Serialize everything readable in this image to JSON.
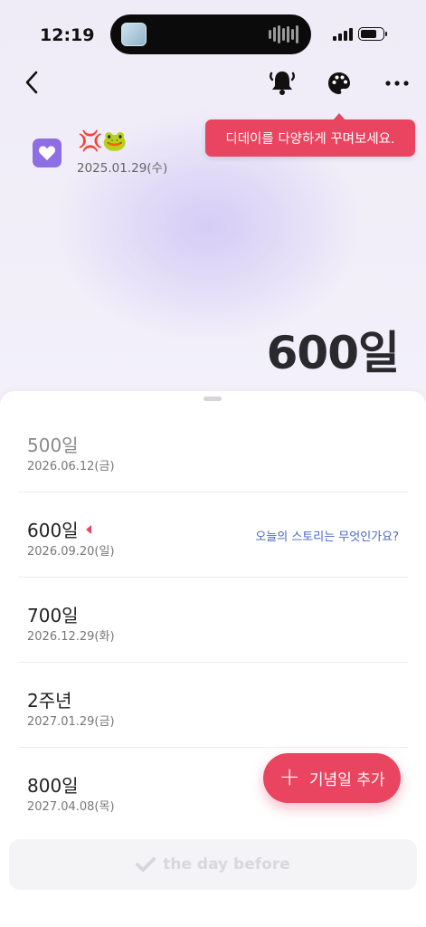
{
  "status_bar": {
    "time": "12:19"
  },
  "tooltip": {
    "text": "디데이를 다양하게 꾸며보세요."
  },
  "header": {
    "emojis": "💢🐸",
    "start_date": "2025.01.29(수)",
    "day_count": "600일"
  },
  "milestones": [
    {
      "title": "500일",
      "date": "2026.06.12(금)",
      "state": "past"
    },
    {
      "title": "600일",
      "date": "2026.09.20(일)",
      "state": "current"
    },
    {
      "title": "700일",
      "date": "2026.12.29(화)",
      "state": "future"
    },
    {
      "title": "2주년",
      "date": "2027.01.29(금)",
      "state": "future"
    },
    {
      "title": "800일",
      "date": "2027.04.08(목)",
      "state": "future"
    }
  ],
  "story_link": "오늘의 스토리는 무엇인가요?",
  "fab": {
    "label": "기념일 추가"
  },
  "bottom_button": {
    "label": "the day before"
  },
  "colors": {
    "accent": "#e94560",
    "purple": "#8d6ee3",
    "link": "#4a67c8"
  },
  "icons": [
    "back-arrow-icon",
    "alarm-bell-icon",
    "palette-icon",
    "more-dots-icon",
    "heart-icon",
    "plus-icon",
    "check-icon"
  ]
}
